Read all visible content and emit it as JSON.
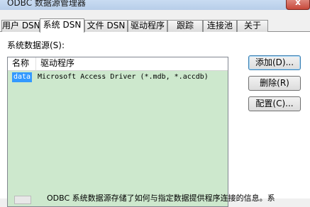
{
  "window": {
    "title": "ODBC 数据源管理器",
    "close_glyph": "x"
  },
  "tabs": [
    {
      "label": "用户 DSN",
      "active": false
    },
    {
      "label": "系统 DSN",
      "active": true
    },
    {
      "label": "文件 DSN",
      "active": false
    },
    {
      "label": "驱动程序",
      "active": false
    },
    {
      "label": "跟踪",
      "active": false
    },
    {
      "label": "连接池",
      "active": false
    },
    {
      "label": "关于",
      "active": false
    }
  ],
  "system_dsn": {
    "group_label": "系统数据源(S):",
    "columns": [
      "名称",
      "驱动程序"
    ],
    "rows": [
      {
        "name": "data",
        "driver": "Microsoft Access Driver (*.mdb, *.accdb)",
        "selected": true
      }
    ],
    "buttons": {
      "add": "添加(D)...",
      "remove": "删除(R)",
      "configure": "配置(C)..."
    },
    "footer_text": "ODBC 系统数据源存储了如何与指定数据提供程序连接的信息。系"
  },
  "colors": {
    "list_background": "#cde8cd",
    "selection": "#3399ff",
    "close_button": "#c7483a"
  }
}
